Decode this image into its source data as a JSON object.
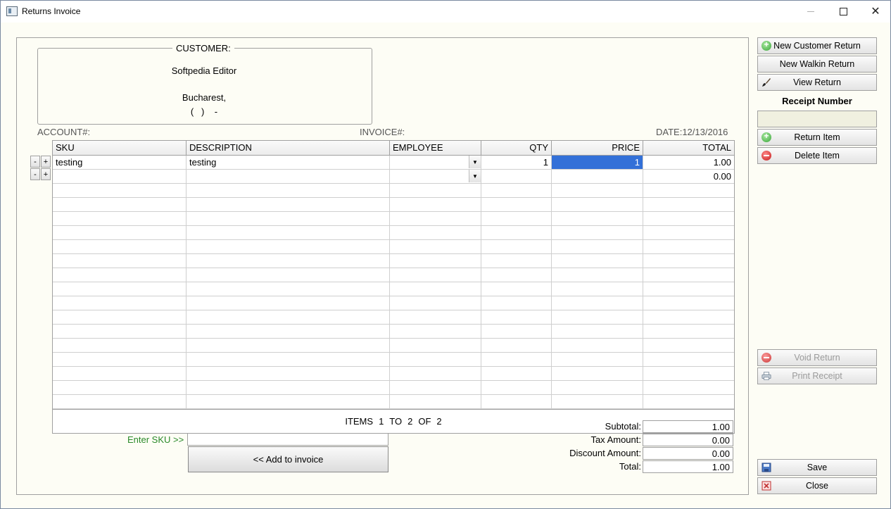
{
  "window": {
    "title": "Returns Invoice"
  },
  "customer": {
    "legend": "CUSTOMER:",
    "name": "Softpedia Editor",
    "city": "Bucharest,",
    "phone": "(   )    -"
  },
  "meta": {
    "account": "ACCOUNT#:",
    "invoice": "INVOICE#:",
    "date": "DATE:12/13/2016"
  },
  "grid": {
    "headers": {
      "sku": "SKU",
      "description": "DESCRIPTION",
      "employee": "EMPLOYEE",
      "qty": "QTY",
      "price": "PRICE",
      "total": "TOTAL"
    },
    "rows": [
      {
        "sku": "testing",
        "description": "testing",
        "employee": "",
        "qty": "1",
        "price": "1",
        "total": "1.00"
      },
      {
        "sku": "",
        "description": "",
        "employee": "",
        "qty": "",
        "price": "",
        "total": "0.00"
      }
    ],
    "row_minus": "-",
    "row_plus": "+",
    "footer": {
      "items": "ITEMS",
      "from": "1",
      "to_word": "TO",
      "to": "2",
      "of_word": "OF",
      "total": "2"
    }
  },
  "entry": {
    "sku_label": "Enter SKU >>",
    "sku_value": "",
    "add_button": "<< Add to invoice"
  },
  "totals": {
    "subtotal_label": "Subtotal:",
    "subtotal": "1.00",
    "tax_label": "Tax Amount:",
    "tax": "0.00",
    "discount_label": "Discount Amount:",
    "discount": "0.00",
    "total_label": "Total:",
    "total": "1.00"
  },
  "sidebar": {
    "new_customer_return": "New Customer Return",
    "new_walkin_return": "New Walkin Return",
    "view_return": "View Return",
    "receipt_number_label": "Receipt Number",
    "receipt_number_value": "",
    "return_item": "Return Item",
    "delete_item": "Delete Item",
    "void_return": "Void Return",
    "print_receipt": "Print Receipt",
    "save": "Save",
    "close": "Close"
  }
}
